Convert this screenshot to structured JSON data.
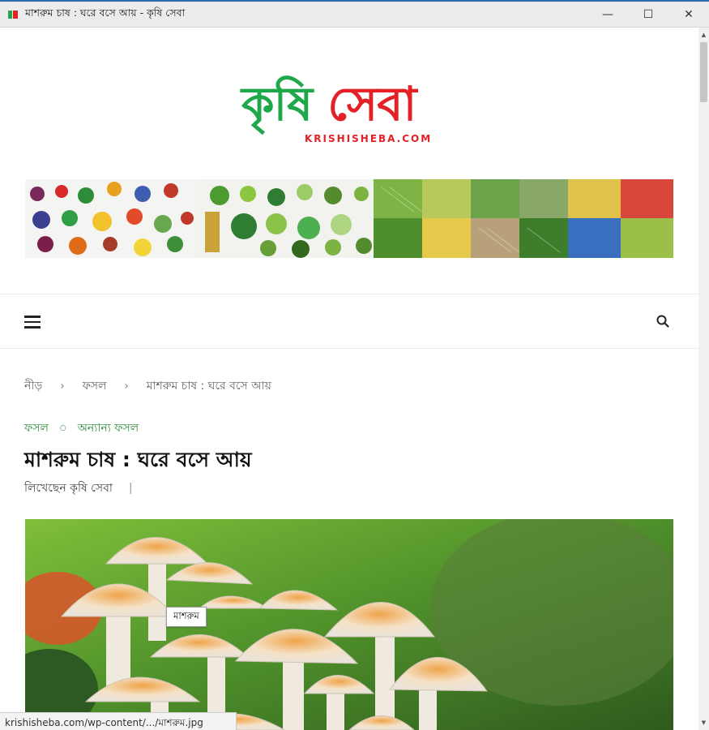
{
  "window": {
    "title": "মাশরুম চাষ : ঘরে বসে আয় - কৃষি সেবা",
    "minimize": "—",
    "maximize": "☐",
    "close": "✕"
  },
  "logo": {
    "part1": "কৃষি",
    "part2": "সেবা",
    "subtitle": "KRISHISHEBA.COM"
  },
  "nav": {
    "menu_icon": "hamburger-icon",
    "search_icon": "search-icon"
  },
  "breadcrumb": {
    "items": [
      "নীড়",
      "ফসল",
      "মাশরুম চাষ : ঘরে বসে আয়"
    ],
    "separator": "›"
  },
  "categories": {
    "items": [
      "ফসল",
      "অন্যান্য ফসল"
    ],
    "separator": "○"
  },
  "post": {
    "title": "মাশরুম চাষ : ঘরে বসে আয়",
    "byline": "লিখেছেন কৃষি সেবা",
    "byline_sep": "|",
    "image_tooltip": "মাশরুম"
  },
  "status_bar": {
    "url": "krishisheba.com/wp-content/.../মাশরুম.jpg"
  },
  "colors": {
    "brand_green": "#1fa84a",
    "brand_red": "#e32126",
    "category_green": "#2f8a3e"
  }
}
